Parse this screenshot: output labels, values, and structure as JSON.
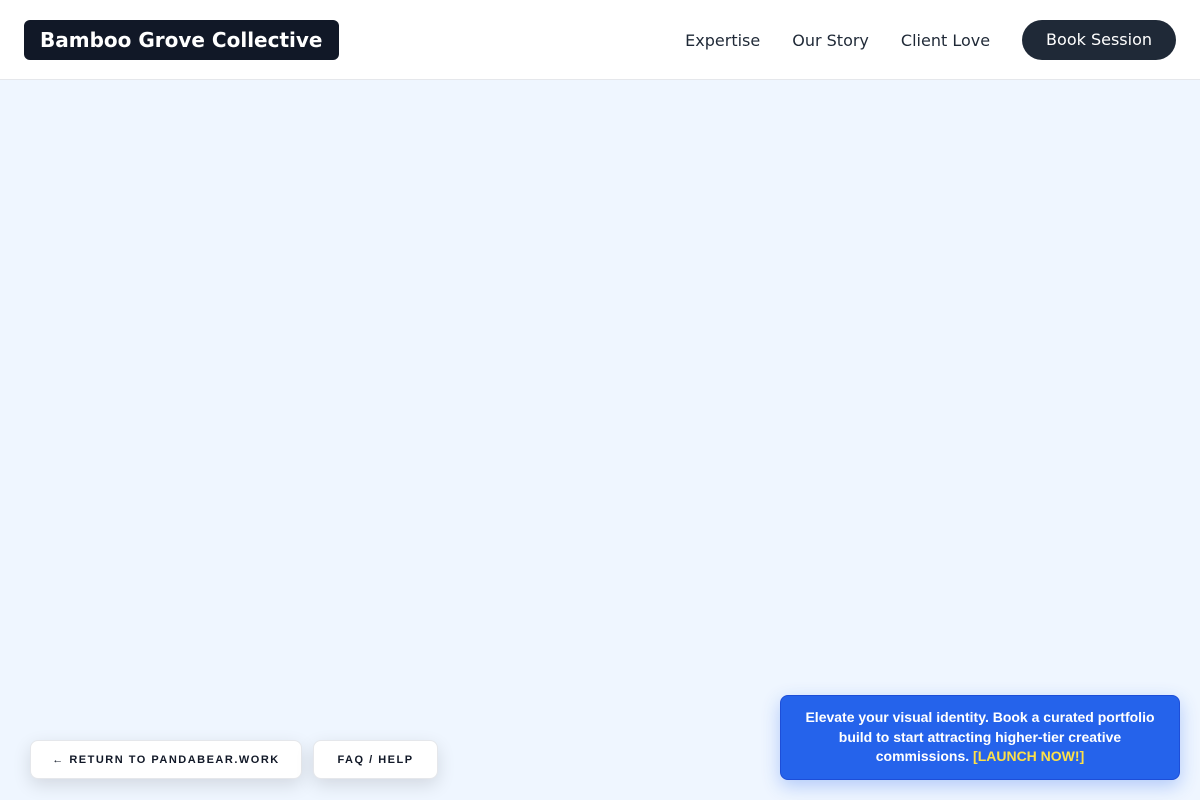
{
  "header": {
    "brand": "Bamboo Grove Collective",
    "nav": [
      {
        "label": "Expertise"
      },
      {
        "label": "Our Story"
      },
      {
        "label": "Client Love"
      }
    ],
    "cta_label": "Book Session"
  },
  "footer_buttons": {
    "return_label": "← RETURN TO PANDABEAR.WORK",
    "faq_label": "FAQ / HELP"
  },
  "promo": {
    "text": "Elevate your visual identity. Book a curated portfolio build to start attracting higher-tier creative commissions.",
    "cta": "[LAUNCH NOW!]"
  },
  "colors": {
    "page_background": "#eff6ff",
    "header_background": "#ffffff",
    "brand_background": "#111827",
    "cta_background": "#1f2937",
    "promo_background": "#2563eb",
    "promo_cta": "#fde047"
  }
}
